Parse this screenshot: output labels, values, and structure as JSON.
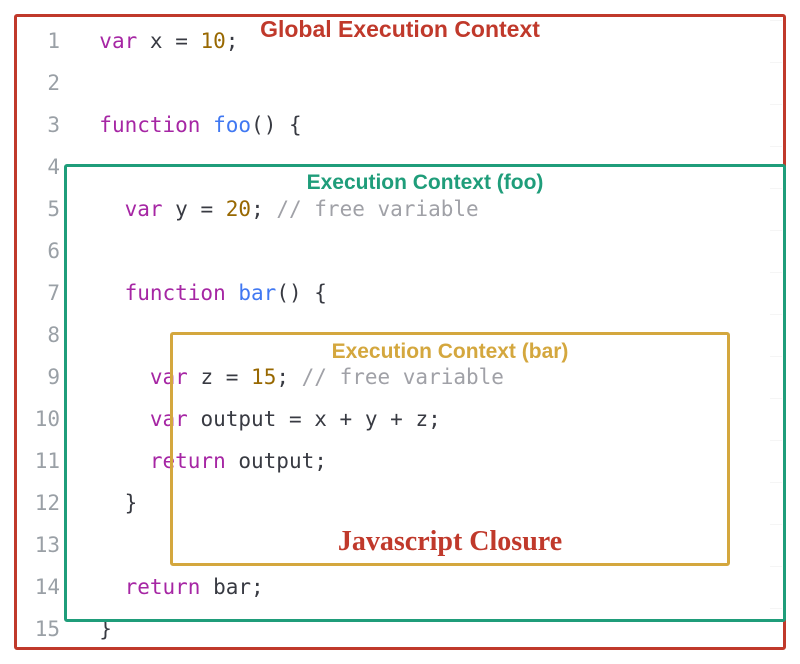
{
  "labels": {
    "global": "Global Execution Context",
    "foo": "Execution Context (foo)",
    "bar": "Execution Context (bar)",
    "closure": "Javascript Closure"
  },
  "colors": {
    "global_border": "#c0392b",
    "foo_border": "#1f9d7a",
    "bar_border": "#d4a73e",
    "closure_text": "#c0392b",
    "keyword": "#a626a4",
    "function_name": "#4078f2",
    "number": "#986801",
    "comment": "#a0a1a7",
    "variable": "#e45649"
  },
  "gutter": [
    "1",
    "2",
    "3",
    "4",
    "5",
    "6",
    "7",
    "8",
    "9",
    "10",
    "11",
    "12",
    "13",
    "14",
    "15"
  ],
  "code_lines": {
    "l1": {
      "indent": "  ",
      "kw": "var",
      "sp": " ",
      "id": "x",
      "eq": " = ",
      "num": "10",
      "semi": ";"
    },
    "l2": {
      "indent": "",
      "text": ""
    },
    "l3": {
      "indent": "  ",
      "kw": "function",
      "sp": " ",
      "fn": "foo",
      "paren": "() {",
      "rest": ""
    },
    "l4": {
      "indent": "",
      "text": ""
    },
    "l5": {
      "indent": "    ",
      "kw": "var",
      "sp": " ",
      "id": "y",
      "eq": " = ",
      "num": "20",
      "semi": "; ",
      "comm": "// free variable"
    },
    "l6": {
      "indent": "",
      "text": ""
    },
    "l7": {
      "indent": "    ",
      "kw": "function",
      "sp": " ",
      "fn": "bar",
      "paren": "() {",
      "rest": ""
    },
    "l8": {
      "indent": "",
      "text": ""
    },
    "l9": {
      "indent": "      ",
      "kw": "var",
      "sp": " ",
      "id": "z",
      "eq": " = ",
      "num": "15",
      "semi": "; ",
      "comm": "// free variable"
    },
    "l10": {
      "indent": "      ",
      "kw": "var",
      "sp": " ",
      "id": "output",
      "eq": " = ",
      "expr_x": "x",
      "plus1": " + ",
      "expr_y": "y",
      "plus2": " + ",
      "expr_z": "z",
      "semi": ";"
    },
    "l11": {
      "indent": "      ",
      "kw": "return",
      "sp": " ",
      "id": "output",
      "semi": ";"
    },
    "l12": {
      "indent": "    ",
      "brace": "}"
    },
    "l13": {
      "indent": "",
      "text": ""
    },
    "l14": {
      "indent": "    ",
      "kw": "return",
      "sp": " ",
      "id": "bar",
      "semi": ";"
    },
    "l15": {
      "indent": "  ",
      "brace": "}"
    }
  }
}
